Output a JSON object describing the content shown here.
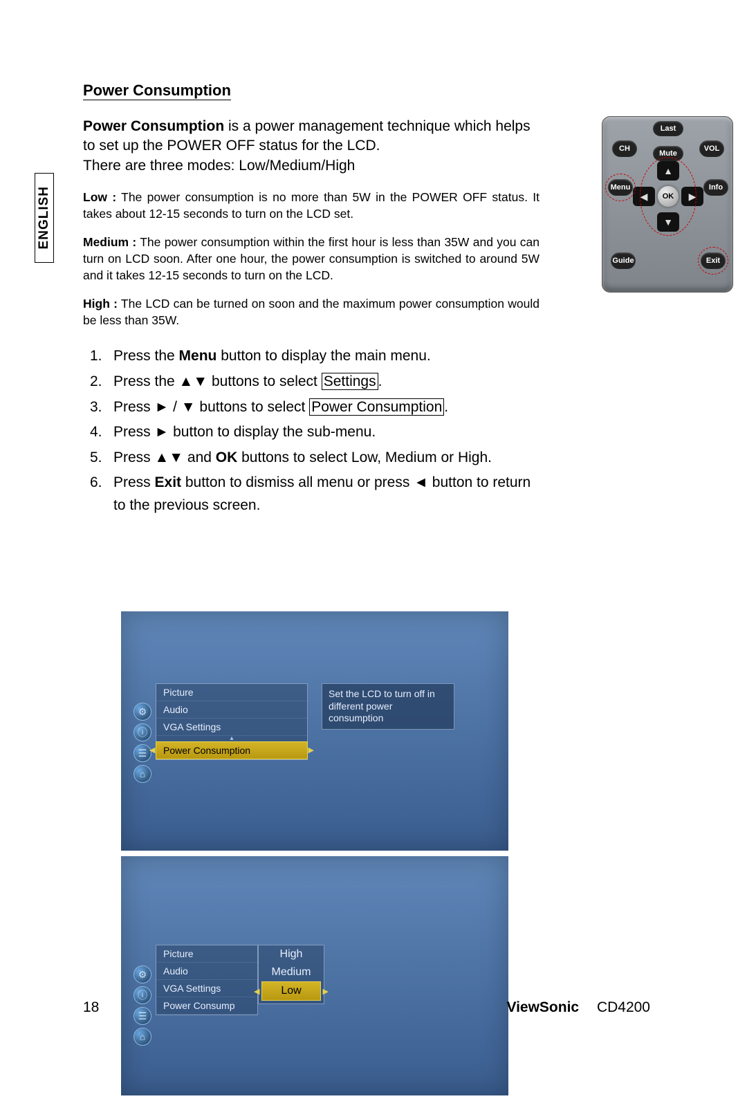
{
  "language": "ENGLISH",
  "section_title": "Power Consumption",
  "intro": {
    "bold": "Power Consumption",
    "rest": " is a power management technique which helps to set up the POWER OFF status for the LCD.",
    "line2": "There are three modes: Low/Medium/High"
  },
  "modes": {
    "low": {
      "label": "Low :",
      "text": " The power consumption is no more than 5W in the POWER OFF status. It takes about 12-15 seconds to turn on the LCD set."
    },
    "medium": {
      "label": "Medium :",
      "text": " The power consumption within the first hour is less than 35W and you can turn on LCD soon. After one hour, the power consumption is switched to around 5W and it takes 12-15 seconds to turn on the LCD."
    },
    "high": {
      "label": "High :",
      "text": " The LCD can be turned on soon and the maximum power consumption would be less than 35W."
    }
  },
  "steps": [
    {
      "n": "1.",
      "pre": "Press the ",
      "bold": "Menu",
      "post": " button to display the main menu."
    },
    {
      "n": "2.",
      "pre": "Press the ▲▼ buttons to select ",
      "box": "Settings",
      "post2": "."
    },
    {
      "n": "3.",
      "pre": "Press ► / ▼ buttons to select ",
      "box": "Power Consumption",
      "post2": "."
    },
    {
      "n": "4.",
      "pre": "Press ► button to display the sub-menu."
    },
    {
      "n": "5.",
      "pre": "Press ▲▼ and ",
      "bold": "OK",
      "post": " buttons to select Low, Medium or High."
    },
    {
      "n": "6.",
      "pre": "Press ",
      "bold": "Exit",
      "post": " button to dismiss all menu or press ◄ button to return to the previous screen."
    }
  ],
  "osd1": {
    "items": [
      "Picture",
      "Audio",
      "VGA Settings"
    ],
    "highlight": "Power Consumption",
    "tooltip": "Set the LCD to turn off in different power consumption"
  },
  "osd2": {
    "items": [
      "Picture",
      "Audio",
      "VGA Settings",
      "Power Consump"
    ],
    "options": [
      "High",
      "Medium"
    ],
    "highlight": "Low"
  },
  "remote": {
    "last": "Last",
    "ch": "CH",
    "vol": "VOL",
    "mute": "Mute",
    "menu": "Menu",
    "info": "Info",
    "ok": "OK",
    "guide": "Guide",
    "exit": "Exit"
  },
  "footer": {
    "page": "18",
    "brand": "ViewSonic",
    "model": "CD4200"
  }
}
